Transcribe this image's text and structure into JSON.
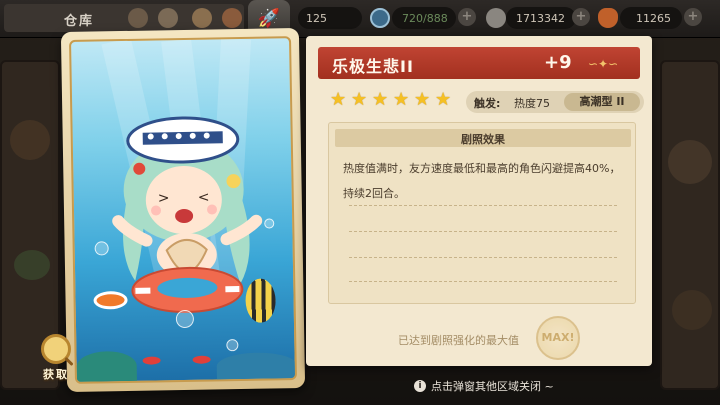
{
  "topbar": {
    "title": "仓库",
    "resources": [
      {
        "name": "ticket",
        "value": "125",
        "icon": "ticket-icon"
      },
      {
        "name": "stamina",
        "value": "720/888",
        "icon": "stamina-icon"
      },
      {
        "name": "coins",
        "value": "1713342",
        "icon": "coin-icon"
      },
      {
        "name": "carrot",
        "value": "11265",
        "icon": "carrot-icon"
      }
    ],
    "plus": "+"
  },
  "card": {
    "search_label": "获取"
  },
  "panel": {
    "title": "乐极生悲II",
    "level": "+9",
    "stars": 6,
    "trigger_label": "触发:",
    "trigger_value": "热度75",
    "type": "高潮型 II",
    "effect_title": "剧照效果",
    "effect_desc": "热度值满时，友方速度最低和最高的角色闪避提高40%，持续2回合。",
    "max_text": "已达到剧照强化的最大值",
    "max_seal": "MAX!"
  },
  "hint": "点击弹窗其他区域关闭 ~",
  "colors": {
    "header_red": "#b03a29",
    "panel_bg": "#f3e8d0",
    "star": "#f5c024"
  }
}
